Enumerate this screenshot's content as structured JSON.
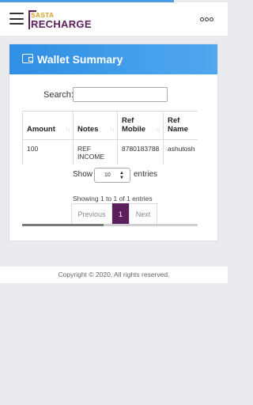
{
  "header": {
    "logo_top": "SASTA",
    "logo_bottom": "RECHARGE"
  },
  "card": {
    "title": "Wallet Summary"
  },
  "search": {
    "label": "Search:",
    "value": ""
  },
  "table": {
    "columns": [
      "Amount",
      "Notes",
      "Ref Mobile",
      "Ref Name"
    ],
    "rows": [
      [
        "100",
        "REF INCOME",
        "8780183788",
        "ashutosh"
      ]
    ]
  },
  "length": {
    "show": "Show",
    "value": "10",
    "entries": "entries"
  },
  "info": "Showing 1 to 1 of 1 entries",
  "pagination": {
    "prev": "Previous",
    "current": "1",
    "next": "Next"
  },
  "footer": "Copyright © 2020, All rights reserved.",
  "colors": {
    "accent_blue": "#2f8fe3",
    "brand_purple": "#5b1f5d",
    "brand_gold": "#d4a126"
  }
}
